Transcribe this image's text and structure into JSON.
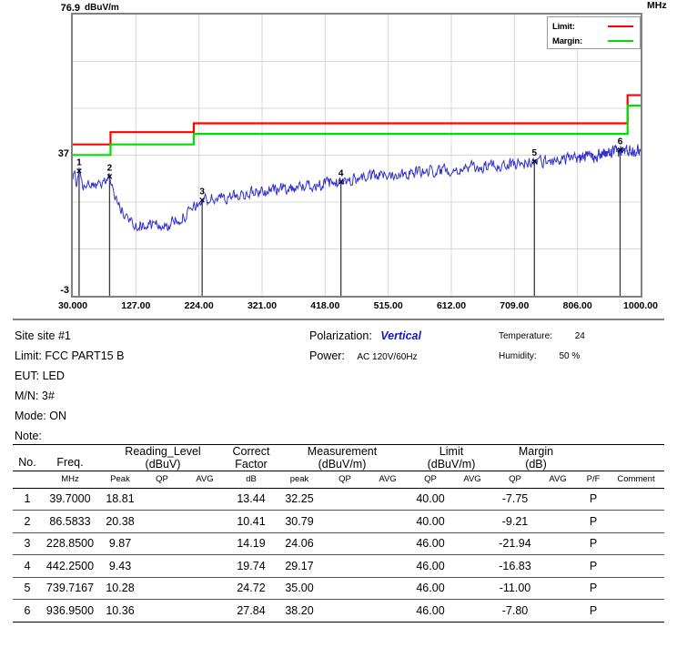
{
  "chart_data": {
    "type": "line",
    "title": "",
    "xlabel": "MHz",
    "ylabel": "dBuV/m",
    "xlim": [
      30,
      1000
    ],
    "ylim": [
      -3,
      76.9
    ],
    "y_axis": {
      "max_label": "76.9",
      "mid_label": "37",
      "min_label": "-3",
      "unit": "dBuV/m"
    },
    "x_ticks": [
      "30.000",
      "127.00",
      "224.00",
      "321.00",
      "418.00",
      "515.00",
      "612.00",
      "709.00",
      "806.00",
      "1000.00"
    ],
    "x_tick_values": [
      30,
      127,
      224,
      321,
      418,
      515,
      612,
      709,
      806,
      1000
    ],
    "x_unit": "MHz",
    "grid": true,
    "legend_position": "top-right",
    "legend": [
      {
        "label": "Limit:",
        "color": "#ff0000"
      },
      {
        "label": "Margin:",
        "color": "#00e000"
      }
    ],
    "series": [
      {
        "name": "Limit",
        "color": "#ff0000",
        "type": "step",
        "points": [
          [
            30,
            40
          ],
          [
            88,
            40
          ],
          [
            88,
            43.5
          ],
          [
            216,
            43.5
          ],
          [
            216,
            46
          ],
          [
            960,
            46
          ],
          [
            960,
            54
          ],
          [
            1000,
            54
          ]
        ]
      },
      {
        "name": "Margin",
        "color": "#00e000",
        "type": "step",
        "points": [
          [
            30,
            37
          ],
          [
            88,
            37
          ],
          [
            88,
            40
          ],
          [
            216,
            40
          ],
          [
            216,
            43
          ],
          [
            960,
            43
          ],
          [
            960,
            51
          ],
          [
            1000,
            51
          ]
        ]
      },
      {
        "name": "Trace",
        "color": "#3333cc",
        "type": "spectrum"
      }
    ],
    "markers": [
      {
        "no": "1",
        "freq": 39.7,
        "level": 32.25
      },
      {
        "no": "2",
        "freq": 86.5833,
        "level": 30.79
      },
      {
        "no": "3",
        "freq": 228.85,
        "level": 24.06
      },
      {
        "no": "4",
        "freq": 442.25,
        "level": 29.17
      },
      {
        "no": "5",
        "freq": 739.7167,
        "level": 35.0
      },
      {
        "no": "6",
        "freq": 936.95,
        "level": 38.2
      }
    ]
  },
  "info": {
    "site_label": "Site",
    "site_value": "site #1",
    "limit_label": "Limit:",
    "limit_value": "FCC PART15 B",
    "eut_label": "EUT:",
    "eut_value": "LED",
    "mn_label": "M/N:",
    "mn_value": "3#",
    "mode_label": "Mode:",
    "mode_value": "ON",
    "note_label": "Note:",
    "note_value": "",
    "polarization_label": "Polarization:",
    "polarization_value": "Vertical",
    "power_label": "Power:",
    "power_value": "AC 120V/60Hz",
    "temperature_label": "Temperature:",
    "temperature_value": "24",
    "humidity_label": "Humidity:",
    "humidity_value": "50 %"
  },
  "table": {
    "group_headers": {
      "no": "No.",
      "freq": "Freq.",
      "reading_level": "Reading_Level",
      "reading_level_unit": "(dBuV)",
      "correct": "Correct",
      "correct_factor": "Factor",
      "measurement": "Measurement",
      "measurement_unit": "(dBuV/m)",
      "limit": "Limit",
      "limit_unit": "(dBuV/m)",
      "margin": "Margin",
      "margin_unit": "(dB)"
    },
    "unit_headers": {
      "no": "",
      "freq": "MHz",
      "rl_peak": "Peak",
      "rl_qp": "QP",
      "rl_avg": "AVG",
      "cf_db": "dB",
      "m_peak": "peak",
      "m_qp": "QP",
      "m_avg": "AVG",
      "l_qp": "QP",
      "l_avg": "AVG",
      "mg_qp": "QP",
      "mg_avg": "AVG",
      "pf": "P/F",
      "comment": "Comment"
    },
    "rows": [
      {
        "no": "1",
        "freq": "39.7000",
        "rl_peak": "18.81",
        "rl_qp": "",
        "rl_avg": "",
        "cf_db": "13.44",
        "m_peak": "32.25",
        "m_qp": "",
        "m_avg": "",
        "l_qp": "40.00",
        "l_avg": "",
        "mg_qp": "-7.75",
        "mg_avg": "",
        "pf": "P",
        "comment": ""
      },
      {
        "no": "2",
        "freq": "86.5833",
        "rl_peak": "20.38",
        "rl_qp": "",
        "rl_avg": "",
        "cf_db": "10.41",
        "m_peak": "30.79",
        "m_qp": "",
        "m_avg": "",
        "l_qp": "40.00",
        "l_avg": "",
        "mg_qp": "-9.21",
        "mg_avg": "",
        "pf": "P",
        "comment": ""
      },
      {
        "no": "3",
        "freq": "228.8500",
        "rl_peak": "9.87",
        "rl_qp": "",
        "rl_avg": "",
        "cf_db": "14.19",
        "m_peak": "24.06",
        "m_qp": "",
        "m_avg": "",
        "l_qp": "46.00",
        "l_avg": "",
        "mg_qp": "-21.94",
        "mg_avg": "",
        "pf": "P",
        "comment": ""
      },
      {
        "no": "4",
        "freq": "442.2500",
        "rl_peak": "9.43",
        "rl_qp": "",
        "rl_avg": "",
        "cf_db": "19.74",
        "m_peak": "29.17",
        "m_qp": "",
        "m_avg": "",
        "l_qp": "46.00",
        "l_avg": "",
        "mg_qp": "-16.83",
        "mg_avg": "",
        "pf": "P",
        "comment": ""
      },
      {
        "no": "5",
        "freq": "739.7167",
        "rl_peak": "10.28",
        "rl_qp": "",
        "rl_avg": "",
        "cf_db": "24.72",
        "m_peak": "35.00",
        "m_qp": "",
        "m_avg": "",
        "l_qp": "46.00",
        "l_avg": "",
        "mg_qp": "-11.00",
        "mg_avg": "",
        "pf": "P",
        "comment": ""
      },
      {
        "no": "6",
        "freq": "936.9500",
        "rl_peak": "10.36",
        "rl_qp": "",
        "rl_avg": "",
        "cf_db": "27.84",
        "m_peak": "38.20",
        "m_qp": "",
        "m_avg": "",
        "l_qp": "46.00",
        "l_avg": "",
        "mg_qp": "-7.80",
        "mg_avg": "",
        "pf": "P",
        "comment": ""
      }
    ]
  }
}
